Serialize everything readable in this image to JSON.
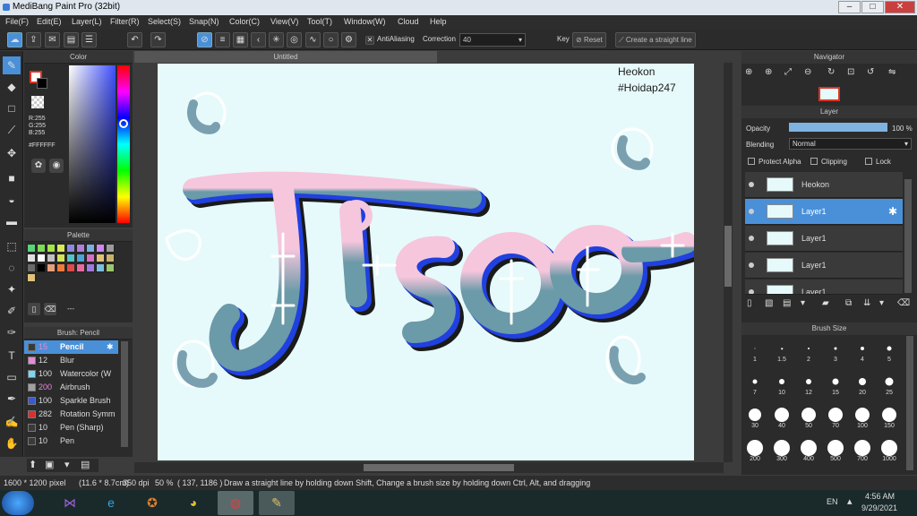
{
  "window": {
    "title": "MediBang Paint Pro (32bit)",
    "minimize": "–",
    "maximize": "□",
    "close": "✕"
  },
  "menu": [
    "File(F)",
    "Edit(E)",
    "Layer(L)",
    "Filter(R)",
    "Select(S)",
    "Snap(N)",
    "Color(C)",
    "View(V)",
    "Tool(T)",
    "Window(W)",
    "Cloud",
    "Help"
  ],
  "toolbar": {
    "antialiasing": "AntiAliasing",
    "correction_label": "Correction",
    "correction_value": "40",
    "key_label": "Key",
    "reset_label": "Reset",
    "straight_line_label": "Create a straight line"
  },
  "color_panel": {
    "title": "Color",
    "r": "R:255",
    "g": "G:255",
    "b": "B:255",
    "hex": "#FFFFFF"
  },
  "palette_panel": {
    "title": "Palette",
    "footer_label": "---",
    "swatches": [
      "#5ad27b",
      "#7ed957",
      "#a6e34a",
      "#d8e85c",
      "#8a8ae0",
      "#b07fd8",
      "#7ab0e0",
      "#cc88ee",
      "#9b9b9b",
      "#e0e0e0",
      "#ffffff",
      "#c0c0c0",
      "#d2e35a",
      "#54c4c8",
      "#4ba3d8",
      "#d66fc4",
      "#e3c07a",
      "#c9b26b",
      "#6a6a6a",
      "#000000",
      "#e8a07a",
      "#f07a3a",
      "#e04a4a",
      "#e86aa0",
      "#a07ae0",
      "#7ac0e0",
      "#9bc76a",
      "#e0c37a"
    ]
  },
  "brush_panel": {
    "title": "Brush: Pencil",
    "brushes": [
      {
        "size": "15",
        "name": "Pencil",
        "color": "#3a3a3a"
      },
      {
        "size": "12",
        "name": "Blur",
        "color": "#e58bd6"
      },
      {
        "size": "100",
        "name": "Watercolor (W",
        "color": "#7fd4f0"
      },
      {
        "size": "200",
        "name": "Airbrush",
        "color": "#a0a0a0"
      },
      {
        "size": "100",
        "name": "Sparkle Brush",
        "color": "#3a5ad0"
      },
      {
        "size": "282",
        "name": "Rotation Symm",
        "color": "#d83030"
      },
      {
        "size": "10",
        "name": "Pen (Sharp)",
        "color": "#3a3a3a"
      },
      {
        "size": "10",
        "name": "Pen",
        "color": "#3a3a3a"
      }
    ]
  },
  "document": {
    "tab": "Untitled",
    "credit_line1": "Heokon",
    "credit_line2": "#Hoidap247",
    "canvas_bg": "#e6fafb"
  },
  "navigator": {
    "title": "Navigator"
  },
  "layer_panel": {
    "title": "Layer",
    "opacity_label": "Opacity",
    "opacity_value": "100 %",
    "opacity_fraction": 1.0,
    "blending_label": "Blending",
    "blending_value": "Normal",
    "protect_alpha": "Protect Alpha",
    "clipping": "Clipping",
    "lock": "Lock",
    "layers": [
      {
        "name": "Heokon",
        "selected": false
      },
      {
        "name": "Layer1",
        "selected": true
      },
      {
        "name": "Layer1",
        "selected": false
      },
      {
        "name": "Layer1",
        "selected": false
      },
      {
        "name": "Layer1",
        "selected": false
      }
    ]
  },
  "brush_size_panel": {
    "title": "Brush Size",
    "sizes": [
      "1",
      "1.5",
      "2",
      "3",
      "4",
      "5",
      "7",
      "10",
      "12",
      "15",
      "20",
      "25",
      "30",
      "40",
      "50",
      "70",
      "100",
      "150",
      "200",
      "300",
      "400",
      "500",
      "700",
      "1000"
    ]
  },
  "status": {
    "dimensions": "1600 * 1200 pixel",
    "physical": "(11.6 * 8.7cm)",
    "dpi": "350 dpi",
    "zoom": "50 %",
    "coords": "( 137, 1186 )",
    "hint": "Draw a straight line by holding down Shift, Change a brush size by holding down Ctrl, Alt, and dragging"
  },
  "taskbar": {
    "lang": "EN",
    "time": "4:56 AM",
    "date": "9/29/2021"
  }
}
